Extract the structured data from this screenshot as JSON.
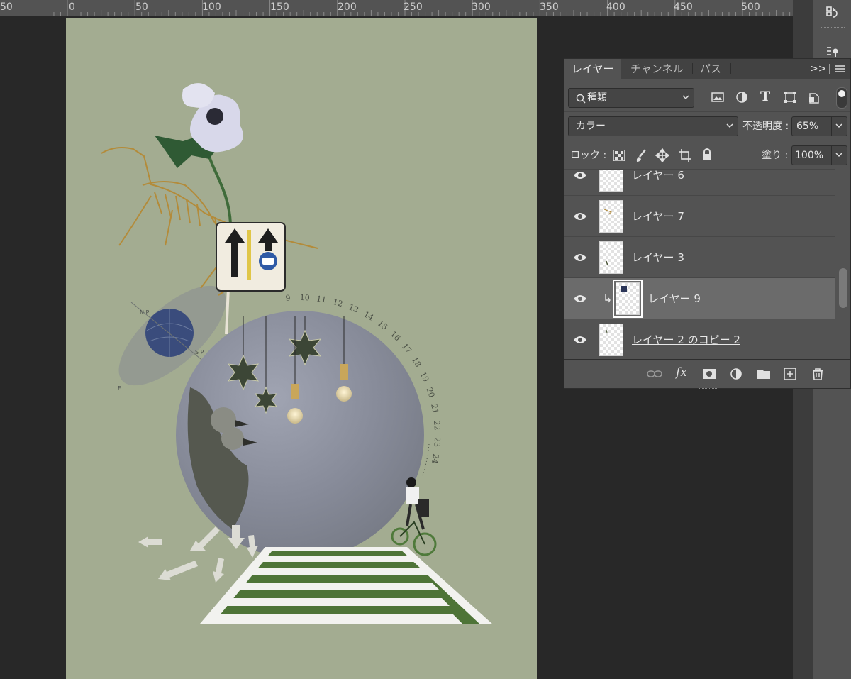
{
  "ruler": {
    "labels": [
      "50",
      "0",
      "50",
      "100",
      "150",
      "200",
      "250",
      "300",
      "350",
      "400",
      "450",
      "500"
    ]
  },
  "panel": {
    "tabs": [
      "レイヤー",
      "チャンネル",
      "パス"
    ],
    "collapse_label": ">>",
    "filter": {
      "icon": "search-icon",
      "value": "種類"
    },
    "blend_mode": "カラー",
    "opacity": {
      "label": "不透明度 :",
      "value": "65%"
    },
    "lock_label": "ロック :",
    "fill": {
      "label": "塗り :",
      "value": "100%"
    },
    "layers": [
      {
        "name": "レイヤー 6",
        "visible": true,
        "selected": false,
        "clipped": false
      },
      {
        "name": "レイヤー 7",
        "visible": true,
        "selected": false,
        "clipped": false
      },
      {
        "name": "レイヤー 3",
        "visible": true,
        "selected": false,
        "clipped": false
      },
      {
        "name": "レイヤー 9",
        "visible": true,
        "selected": true,
        "clipped": true
      },
      {
        "name": "レイヤー 2 のコピー 2",
        "visible": true,
        "selected": false,
        "clipped": false
      }
    ],
    "bottom_buttons": [
      "link-icon",
      "fx-icon",
      "mask-icon",
      "adjustment-icon",
      "folder-icon",
      "new-layer-icon",
      "trash-icon"
    ],
    "fx_label": "fx"
  },
  "canvas": {
    "background_color": "#a3ac91",
    "clock_numbers": [
      "9",
      "10",
      "11",
      "12",
      "13",
      "14",
      "15",
      "16",
      "17",
      "18",
      "19",
      "20",
      "21",
      "22",
      "23",
      "24"
    ],
    "globe_labels": [
      "N P",
      "S P",
      "E"
    ]
  },
  "colors": {
    "panel_bg": "#535353",
    "selected_row": "#6b6b6b",
    "app_bg": "#282828"
  }
}
